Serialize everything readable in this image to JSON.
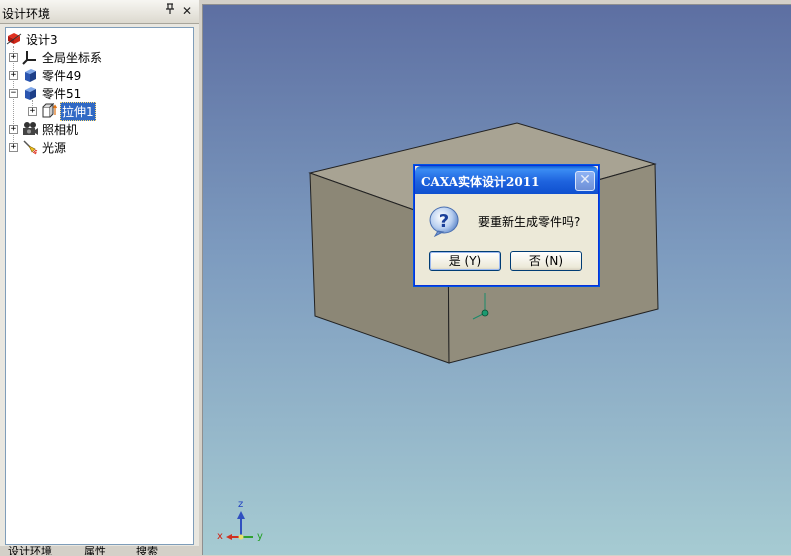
{
  "panel": {
    "title": "设计环境",
    "pin_glyph": "ᵖ",
    "close_glyph": "✕",
    "tree": [
      {
        "label": "设计3",
        "icon": "design-icon",
        "expander": ""
      },
      {
        "label": "全局坐标系",
        "icon": "coordinate-system-icon",
        "expander": "+"
      },
      {
        "label": "零件49",
        "icon": "part-icon",
        "expander": "+"
      },
      {
        "label": "零件51",
        "icon": "part-icon",
        "expander": "−"
      },
      {
        "label": "拉伸1",
        "icon": "extrude-icon",
        "expander": "+",
        "selected": true
      },
      {
        "label": "照相机",
        "icon": "camera-icon",
        "expander": "+"
      },
      {
        "label": "光源",
        "icon": "light-source-icon",
        "expander": "+"
      }
    ],
    "bottom_tabs": [
      "设计环境",
      "属性",
      "搜索"
    ]
  },
  "viewport": {
    "triad": {
      "x": "x",
      "y": "y",
      "z": "z"
    },
    "colors": {
      "bg_top": "#5d6fa2",
      "bg_bottom": "#a6cbd2",
      "box_front": "#8c8776",
      "box_side": "#928d7c",
      "box_top": "#a8a393"
    }
  },
  "dialog": {
    "title": "CAXA实体设计2011",
    "message": "要重新生成零件吗?",
    "yes_label": "是 (Y)",
    "no_label": "否 (N)",
    "close_glyph": "✕",
    "icon": "question-icon"
  }
}
